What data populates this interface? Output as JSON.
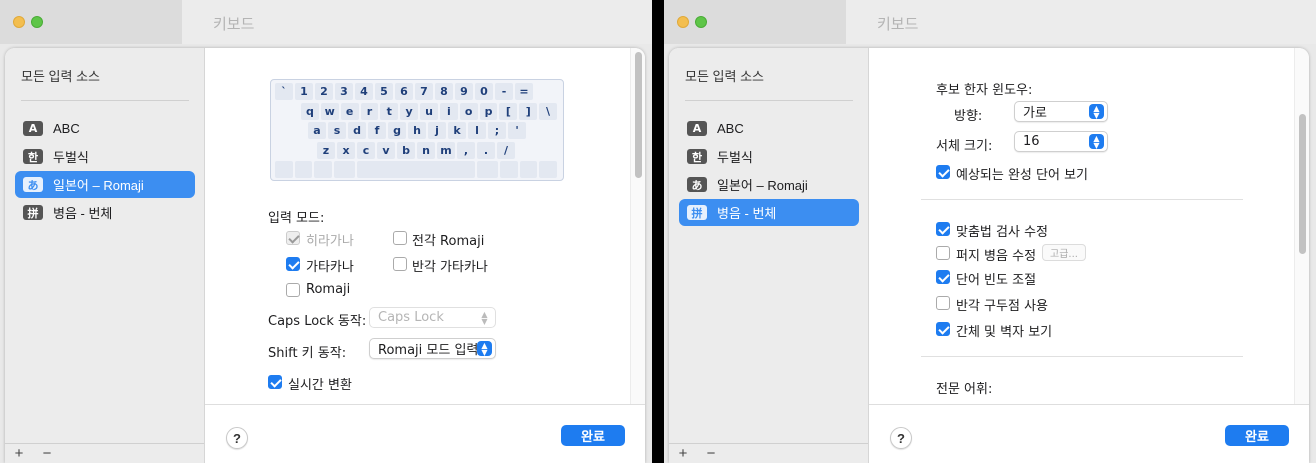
{
  "window_title": "키보드",
  "sidebar": {
    "title": "모든 입력 소스",
    "add": "+",
    "remove": "−",
    "items": [
      {
        "badge": "A",
        "label": "ABC"
      },
      {
        "badge": "한",
        "label": "두벌식"
      },
      {
        "badge": "あ",
        "label": "일본어 – Romaji"
      },
      {
        "badge": "拼",
        "label": "병음 - 번체"
      }
    ]
  },
  "footer": {
    "help": "?",
    "done": "완료"
  },
  "left_panel": {
    "keyboard_rows": [
      [
        "`",
        "1",
        "2",
        "3",
        "4",
        "5",
        "6",
        "7",
        "8",
        "9",
        "0",
        "-",
        "="
      ],
      [
        "q",
        "w",
        "e",
        "r",
        "t",
        "y",
        "u",
        "i",
        "o",
        "p",
        "[",
        "]",
        "\\"
      ],
      [
        "a",
        "s",
        "d",
        "f",
        "g",
        "h",
        "j",
        "k",
        "l",
        ";",
        "'"
      ],
      [
        "z",
        "x",
        "c",
        "v",
        "b",
        "n",
        "m",
        ",",
        ".",
        "/"
      ]
    ],
    "input_mode_label": "입력 모드:",
    "hiragana": "히라가나",
    "fullwidth_romaji": "전각 Romaji",
    "katakana": "가타카나",
    "halfwidth_katakana": "반각 가타카나",
    "romaji": "Romaji",
    "caps_lock_label": "Caps Lock 동작:",
    "caps_lock_value": "Caps Lock",
    "shift_label": "Shift 키 동작:",
    "shift_value": "Romaji 모드 입력",
    "live_conversion": "실시간 변환"
  },
  "right_panel": {
    "candidate_window_label": "후보 한자 윈도우:",
    "direction_label": "방향:",
    "direction_value": "가로",
    "font_size_label": "서체 크기:",
    "font_size_value": "16",
    "predictive": "예상되는 완성 단어 보기",
    "spell_correction": "맞춤법 검사 수정",
    "fuzzy_pinyin": "퍼지 병음 수정",
    "advanced": "고급...",
    "word_frequency": "단어 빈도 조절",
    "halfwidth_punct": "반각 구두점 사용",
    "show_simplified": "간체 및 벽자 보기",
    "vocab_label": "전문 어휘:"
  }
}
